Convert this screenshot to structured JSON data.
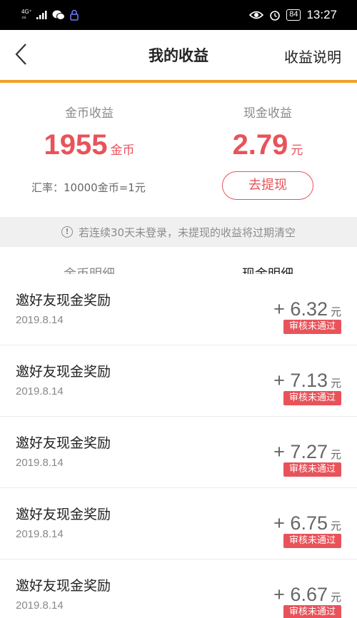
{
  "status_bar": {
    "network_top": "4G⁺",
    "network_bottom": "⁴⁶",
    "battery": "84",
    "time": "13:27"
  },
  "nav": {
    "title": "我的收益",
    "explain": "收益说明"
  },
  "summary": {
    "coin_label": "金币收益",
    "coin_amount": "1955",
    "coin_unit": "金币",
    "cash_label": "现金收益",
    "cash_amount": "2.79",
    "cash_unit": "元",
    "rate": "汇率：10000金币=1元",
    "withdraw_label": "去提现"
  },
  "notice": {
    "text": "若连续30天未登录，未提现的收益将过期清空"
  },
  "tabs": {
    "coin": "金币明细",
    "cash": "现金明细"
  },
  "items": [
    {
      "title": "邀好友现金奖励",
      "date": "2019.8.14",
      "amount": "+ 6.32",
      "unit": "元",
      "status": "审核未通过"
    },
    {
      "title": "邀好友现金奖励",
      "date": "2019.8.14",
      "amount": "+ 7.13",
      "unit": "元",
      "status": "审核未通过"
    },
    {
      "title": "邀好友现金奖励",
      "date": "2019.8.14",
      "amount": "+ 7.27",
      "unit": "元",
      "status": "审核未通过"
    },
    {
      "title": "邀好友现金奖励",
      "date": "2019.8.14",
      "amount": "+ 6.75",
      "unit": "元",
      "status": "审核未通过"
    },
    {
      "title": "邀好友现金奖励",
      "date": "2019.8.14",
      "amount": "+ 6.67",
      "unit": "元",
      "status": "审核未通过"
    }
  ],
  "colors": {
    "accent_red": "#e8535a",
    "divider_orange": "#f5a024"
  }
}
